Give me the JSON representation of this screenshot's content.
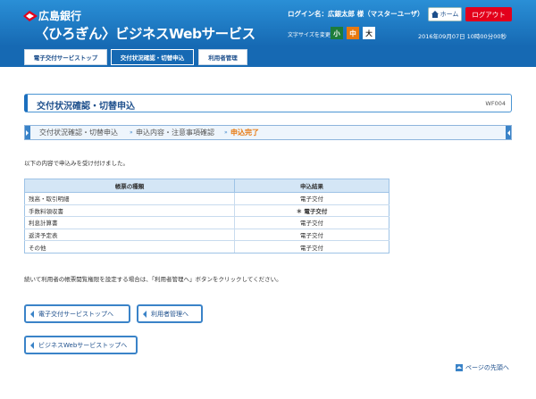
{
  "header": {
    "bank_name": "広島銀行",
    "service_name": "〈ひろぎん〉ビジネスWebサービス",
    "login_name": "ログイン名：広銀太郎 様（マスターユーザ）",
    "home_label": "ホーム",
    "logout_label": "ログアウト",
    "font_size_label": "文字サイズを変更",
    "font_sizes": [
      "小",
      "中",
      "大"
    ],
    "datetime": "2016年09月07日 10時00分00秒"
  },
  "nav": {
    "tabs": [
      {
        "label": "電子交付サービストップ"
      },
      {
        "label": "交付状況確認・切替申込"
      },
      {
        "label": "利用者管理"
      }
    ]
  },
  "page": {
    "title": "交付状況確認・切替申込",
    "id": "WF004"
  },
  "steps": [
    {
      "label": "交付状況確認・切替申込"
    },
    {
      "label": "申込内容・注意事項確認"
    },
    {
      "label": "申込完了"
    }
  ],
  "message": "以下の内容で申込みを受け付けました。",
  "table": {
    "headers": [
      "帳票の種類",
      "申込結果"
    ],
    "rows": [
      {
        "name": "残高・取引明細",
        "result": "電子交付"
      },
      {
        "name": "手数料領収書",
        "result": "＊ 電子交付"
      },
      {
        "name": "利息計算書",
        "result": "電子交付"
      },
      {
        "name": "返済予定表",
        "result": "電子交付"
      },
      {
        "name": "その他",
        "result": "電子交付"
      }
    ]
  },
  "note": "続いて利用者の帳票閲覧権限を設定する場合は、「利用者管理へ」ボタンをクリックしてください。",
  "buttons": {
    "to_top": "電子交付サービストップへ",
    "to_user_mgmt": "利用者管理へ",
    "to_biz_top": "ビジネスWebサービストップへ"
  },
  "page_top": "ページの先頭へ",
  "colors": {
    "header_blue": "#1669b3",
    "logout_red": "#e3001b",
    "current_step_orange": "#e8790f"
  }
}
